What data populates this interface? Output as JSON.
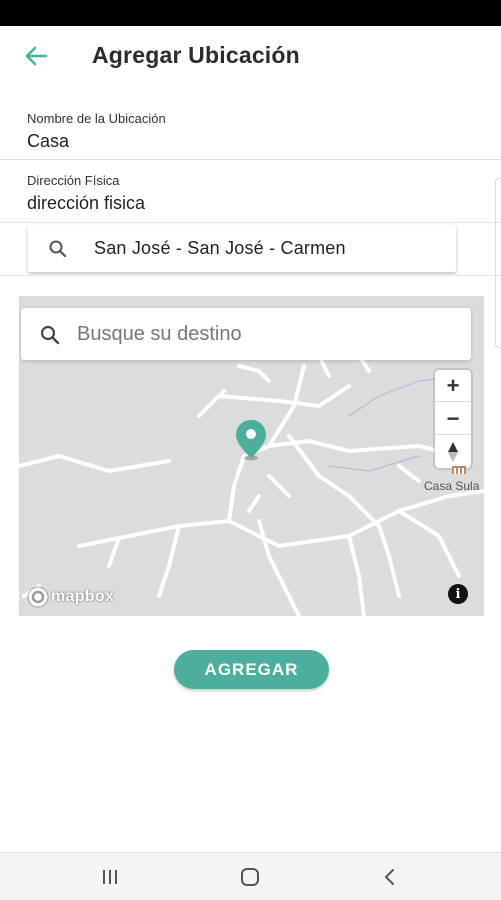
{
  "header": {
    "title": "Agregar Ubicación",
    "back_icon": "arrow-left-icon"
  },
  "form": {
    "name_label": "Nombre de la Ubicación",
    "name_value": "Casa",
    "address_label": "Dirección Física",
    "address_value": "dirección fisica",
    "location_selector": "San José - San José - Carmen"
  },
  "map": {
    "search_placeholder": "Busque su destino",
    "zoom_in": "+",
    "zoom_out": "−",
    "poi_label": "Casa Sula",
    "attribution": "mapbox",
    "info": "i"
  },
  "actions": {
    "add_label": "AGREGAR"
  },
  "colors": {
    "accent": "#4caf9c",
    "pin": "#4caf9c",
    "map_background": "#dcdcdc"
  }
}
